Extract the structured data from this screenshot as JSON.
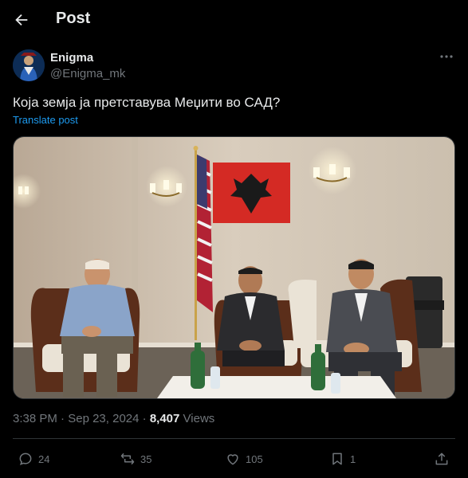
{
  "header": {
    "title": "Post"
  },
  "author": {
    "name": "Enigma",
    "handle": "@Enigma_mk"
  },
  "post": {
    "text": "Која земја ја претставува Меџити во САД?",
    "translate_label": "Translate post"
  },
  "meta": {
    "time": "3:38 PM",
    "separator": "·",
    "date": "Sep 23, 2024",
    "views_count": "8,407",
    "views_label": "Views"
  },
  "actions": {
    "replies": "24",
    "reposts": "35",
    "likes": "105",
    "bookmarks": "1"
  },
  "icons": {
    "back": "arrow-left-icon",
    "more": "more-horizontal-icon",
    "reply": "reply-bubble-icon",
    "repost": "repost-icon",
    "like": "heart-icon",
    "bookmark": "bookmark-icon",
    "share": "share-icon"
  },
  "colors": {
    "background": "#000000",
    "text": "#e7e9ea",
    "secondary": "#71767b",
    "link": "#1d9bf0",
    "border": "#2f3336"
  }
}
